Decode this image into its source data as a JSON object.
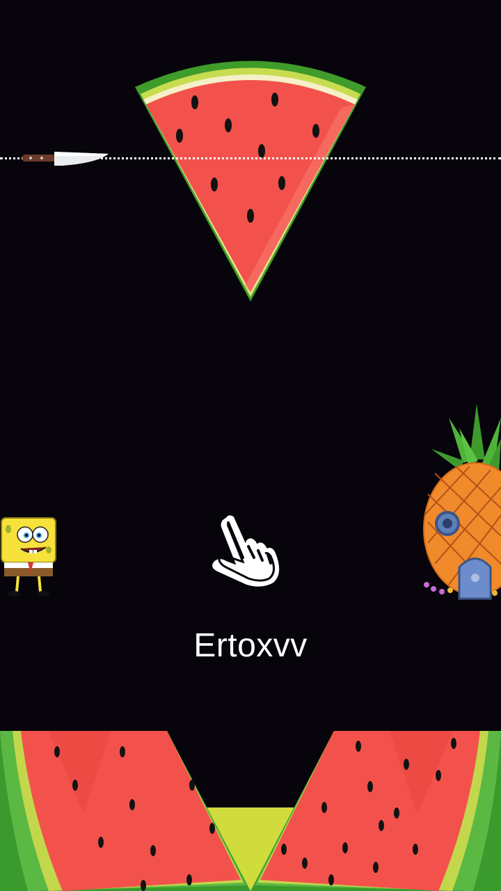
{
  "game": {
    "title_text": "Ertoxvv"
  },
  "icons": {
    "knife": "knife-icon",
    "hand": "tap-hand-icon",
    "character": "spongebob-character",
    "house": "pineapple-house"
  },
  "colors": {
    "background": "#07050b",
    "watermelon_flesh": "#f2524b",
    "watermelon_rind": "#3fae3a",
    "rind_light": "#c8dc55",
    "seed": "#1a1a1a"
  }
}
